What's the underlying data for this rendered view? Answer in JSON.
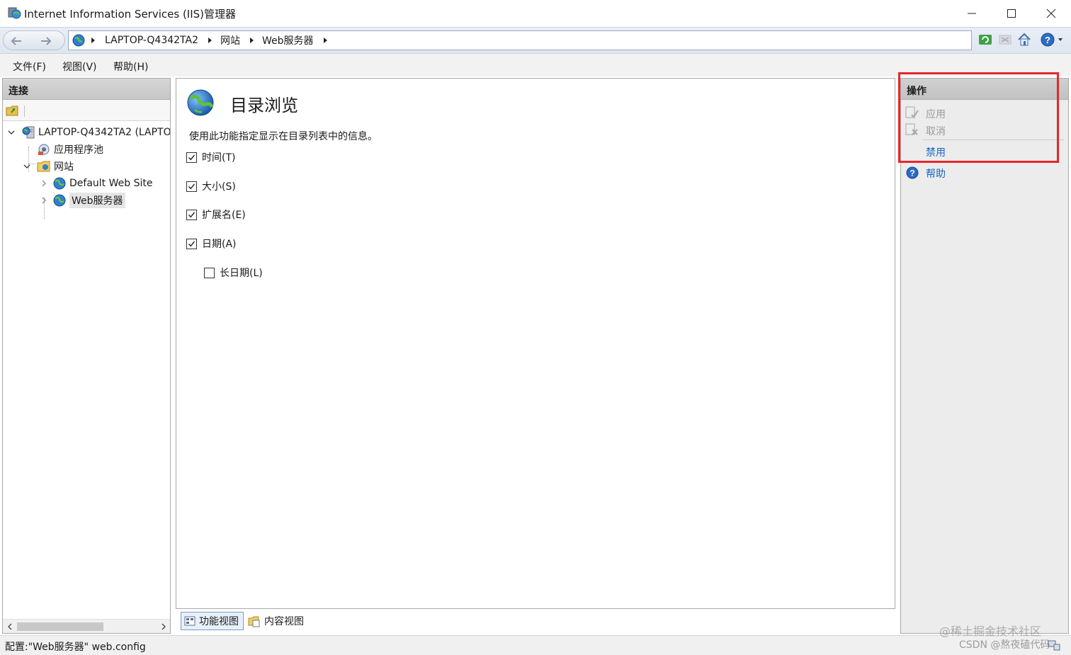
{
  "window": {
    "title": "Internet Information Services (IIS)管理器"
  },
  "address": {
    "crumbs": [
      "LAPTOP-Q4342TA2",
      "网站",
      "Web服务器"
    ]
  },
  "menu": {
    "file": "文件(F)",
    "view": "视图(V)",
    "help": "帮助(H)"
  },
  "connections": {
    "header": "连接",
    "tree": {
      "server": "LAPTOP-Q4342TA2 (LAPTO",
      "app_pools": "应用程序池",
      "sites": "网站",
      "site1": "Default Web Site",
      "site2": "Web服务器"
    }
  },
  "feature": {
    "title": "目录浏览",
    "description": "使用此功能指定显示在目录列表中的信息。",
    "options": [
      {
        "label": "时间(T)",
        "checked": true
      },
      {
        "label": "大小(S)",
        "checked": true
      },
      {
        "label": "扩展名(E)",
        "checked": true
      },
      {
        "label": "日期(A)",
        "checked": true
      },
      {
        "label": "长日期(L)",
        "checked": false
      }
    ]
  },
  "views": {
    "features": "功能视图",
    "content": "内容视图"
  },
  "actions": {
    "header": "操作",
    "apply": "应用",
    "cancel": "取消",
    "disable": "禁用",
    "help": "帮助"
  },
  "status": {
    "text": "配置:\"Web服务器\" web.config"
  },
  "watermark": {
    "line1": "@稀土掘金技术社区",
    "line2": "CSDN @熬夜磕代码"
  },
  "colors": {
    "accent_link": "#1566c0",
    "highlight_box": "#e8262d",
    "disabled_text": "#9a9a9a"
  }
}
